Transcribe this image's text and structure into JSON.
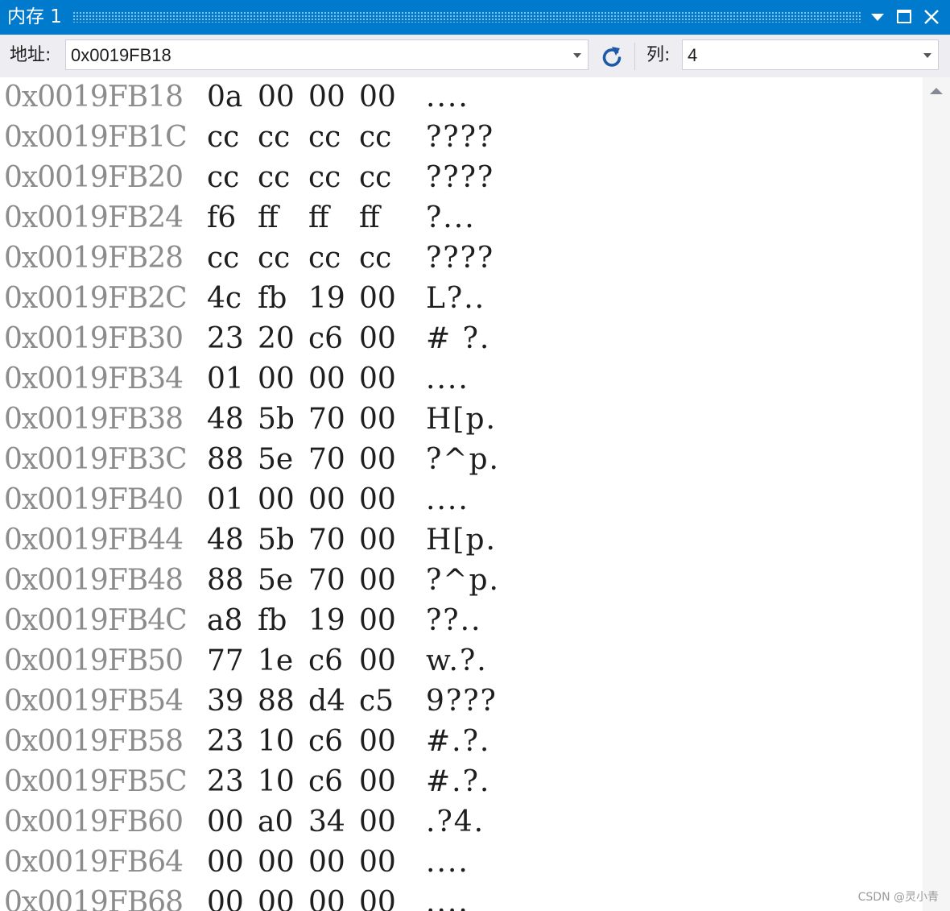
{
  "window": {
    "title": "内存 1"
  },
  "toolbar": {
    "address_label": "地址:",
    "address_value": "0x0019FB18",
    "columns_label": "列:",
    "columns_value": "4"
  },
  "memory_rows": [
    {
      "address": "0x0019FB18",
      "b0": "0a",
      "b1": "00",
      "b2": "00",
      "b3": "00",
      "ascii": "...."
    },
    {
      "address": "0x0019FB1C",
      "b0": "cc",
      "b1": "cc",
      "b2": "cc",
      "b3": "cc",
      "ascii": "????"
    },
    {
      "address": "0x0019FB20",
      "b0": "cc",
      "b1": "cc",
      "b2": "cc",
      "b3": "cc",
      "ascii": "????"
    },
    {
      "address": "0x0019FB24",
      "b0": "f6",
      "b1": "ff",
      "b2": "ff",
      "b3": "ff",
      "ascii": "?..."
    },
    {
      "address": "0x0019FB28",
      "b0": "cc",
      "b1": "cc",
      "b2": "cc",
      "b3": "cc",
      "ascii": "????"
    },
    {
      "address": "0x0019FB2C",
      "b0": "4c",
      "b1": "fb",
      "b2": "19",
      "b3": "00",
      "ascii": "L?.."
    },
    {
      "address": "0x0019FB30",
      "b0": "23",
      "b1": "20",
      "b2": "c6",
      "b3": "00",
      "ascii": "# ?."
    },
    {
      "address": "0x0019FB34",
      "b0": "01",
      "b1": "00",
      "b2": "00",
      "b3": "00",
      "ascii": "...."
    },
    {
      "address": "0x0019FB38",
      "b0": "48",
      "b1": "5b",
      "b2": "70",
      "b3": "00",
      "ascii": "H[p."
    },
    {
      "address": "0x0019FB3C",
      "b0": "88",
      "b1": "5e",
      "b2": "70",
      "b3": "00",
      "ascii": "?^p."
    },
    {
      "address": "0x0019FB40",
      "b0": "01",
      "b1": "00",
      "b2": "00",
      "b3": "00",
      "ascii": "...."
    },
    {
      "address": "0x0019FB44",
      "b0": "48",
      "b1": "5b",
      "b2": "70",
      "b3": "00",
      "ascii": "H[p."
    },
    {
      "address": "0x0019FB48",
      "b0": "88",
      "b1": "5e",
      "b2": "70",
      "b3": "00",
      "ascii": "?^p."
    },
    {
      "address": "0x0019FB4C",
      "b0": "a8",
      "b1": "fb",
      "b2": "19",
      "b3": "00",
      "ascii": "??.."
    },
    {
      "address": "0x0019FB50",
      "b0": "77",
      "b1": "1e",
      "b2": "c6",
      "b3": "00",
      "ascii": "w.?."
    },
    {
      "address": "0x0019FB54",
      "b0": "39",
      "b1": "88",
      "b2": "d4",
      "b3": "c5",
      "ascii": "9???"
    },
    {
      "address": "0x0019FB58",
      "b0": "23",
      "b1": "10",
      "b2": "c6",
      "b3": "00",
      "ascii": "#.?."
    },
    {
      "address": "0x0019FB5C",
      "b0": "23",
      "b1": "10",
      "b2": "c6",
      "b3": "00",
      "ascii": "#.?."
    },
    {
      "address": "0x0019FB60",
      "b0": "00",
      "b1": "a0",
      "b2": "34",
      "b3": "00",
      "ascii": ".?4."
    },
    {
      "address": "0x0019FB64",
      "b0": "00",
      "b1": "00",
      "b2": "00",
      "b3": "00",
      "ascii": "...."
    },
    {
      "address": "0x0019FB68",
      "b0": "00",
      "b1": "00",
      "b2": "00",
      "b3": "00",
      "ascii": "...."
    }
  ],
  "watermark": "CSDN @灵小青",
  "colors": {
    "titlebar": "#007acc",
    "toolbar": "#eeeef2",
    "address_text": "#8c8c8c",
    "byte_text": "#1e1e1e"
  }
}
